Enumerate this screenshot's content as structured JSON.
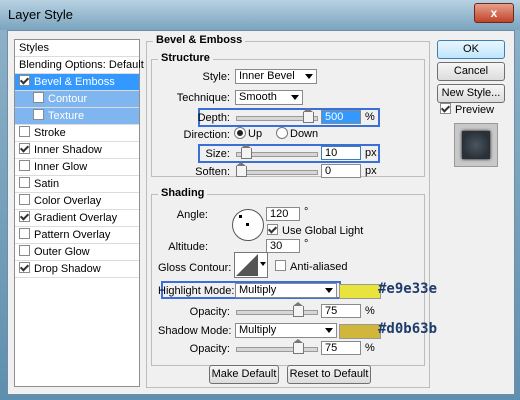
{
  "window": {
    "title": "Layer Style",
    "close_glyph": "x"
  },
  "styles_panel": {
    "items": [
      {
        "label": "Styles",
        "checkbox": false,
        "checked": false,
        "state": "header"
      },
      {
        "label": "Blending Options: Default",
        "checkbox": false,
        "checked": false,
        "state": "normal"
      },
      {
        "label": "Bevel & Emboss",
        "checkbox": true,
        "checked": true,
        "state": "selected"
      },
      {
        "label": "Contour",
        "checkbox": true,
        "checked": false,
        "state": "sub"
      },
      {
        "label": "Texture",
        "checkbox": true,
        "checked": false,
        "state": "sub"
      },
      {
        "label": "Stroke",
        "checkbox": true,
        "checked": false,
        "state": "normal"
      },
      {
        "label": "Inner Shadow",
        "checkbox": true,
        "checked": true,
        "state": "normal"
      },
      {
        "label": "Inner Glow",
        "checkbox": true,
        "checked": false,
        "state": "normal"
      },
      {
        "label": "Satin",
        "checkbox": true,
        "checked": false,
        "state": "normal"
      },
      {
        "label": "Color Overlay",
        "checkbox": true,
        "checked": false,
        "state": "normal"
      },
      {
        "label": "Gradient Overlay",
        "checkbox": true,
        "checked": true,
        "state": "normal"
      },
      {
        "label": "Pattern Overlay",
        "checkbox": true,
        "checked": false,
        "state": "normal"
      },
      {
        "label": "Outer Glow",
        "checkbox": true,
        "checked": false,
        "state": "normal"
      },
      {
        "label": "Drop Shadow",
        "checkbox": true,
        "checked": true,
        "state": "normal"
      }
    ]
  },
  "bevel": {
    "title": "Bevel & Emboss",
    "structure": {
      "title": "Structure",
      "style_label": "Style:",
      "style_value": "Inner Bevel",
      "technique_label": "Technique:",
      "technique_value": "Smooth",
      "depth_label": "Depth:",
      "depth_value": "500",
      "depth_unit": "%",
      "direction_label": "Direction:",
      "dir_up": "Up",
      "dir_down": "Down",
      "size_label": "Size:",
      "size_value": "10",
      "size_unit": "px",
      "soften_label": "Soften:",
      "soften_value": "0",
      "soften_unit": "px"
    },
    "shading": {
      "title": "Shading",
      "angle_label": "Angle:",
      "angle_value": "120",
      "angle_unit": "°",
      "use_global_light": "Use Global Light",
      "altitude_label": "Altitude:",
      "altitude_value": "30",
      "altitude_unit": "°",
      "gloss_label": "Gloss Contour:",
      "anti_aliased": "Anti-aliased",
      "highlight_label": "Highlight Mode:",
      "highlight_value": "Multiply",
      "highlight_color": "#e9e33e",
      "hl_opacity_label": "Opacity:",
      "hl_opacity_value": "75",
      "hl_opacity_unit": "%",
      "shadow_label": "Shadow Mode:",
      "shadow_value": "Multiply",
      "shadow_color": "#d0b63b",
      "sh_opacity_label": "Opacity:",
      "sh_opacity_value": "75",
      "sh_opacity_unit": "%"
    },
    "make_default": "Make Default",
    "reset_default": "Reset to Default"
  },
  "buttons": {
    "ok": "OK",
    "cancel": "Cancel",
    "new_style": "New Style...",
    "preview": "Preview"
  }
}
